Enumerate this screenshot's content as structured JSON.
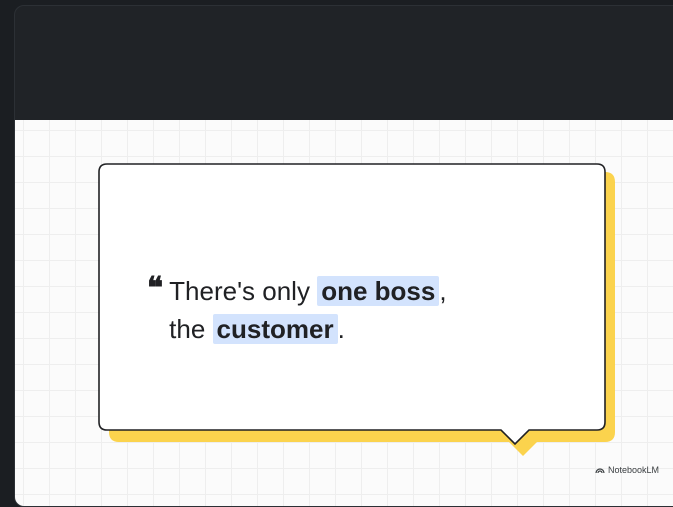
{
  "quote": {
    "mark": "❝",
    "line1_prefix": "There's only ",
    "line1_highlight": "one boss",
    "line1_suffix": ",",
    "line2_prefix": "the ",
    "line2_highlight": "customer",
    "line2_suffix": "."
  },
  "brand": {
    "name": "NotebookLM",
    "icon": "notebooklm-logo-icon"
  },
  "colors": {
    "header": "#202327",
    "slide_background": "#fbfbfb",
    "bubble_shadow": "#fbd34d",
    "highlight": "#d3e3fd",
    "text": "#202124"
  }
}
